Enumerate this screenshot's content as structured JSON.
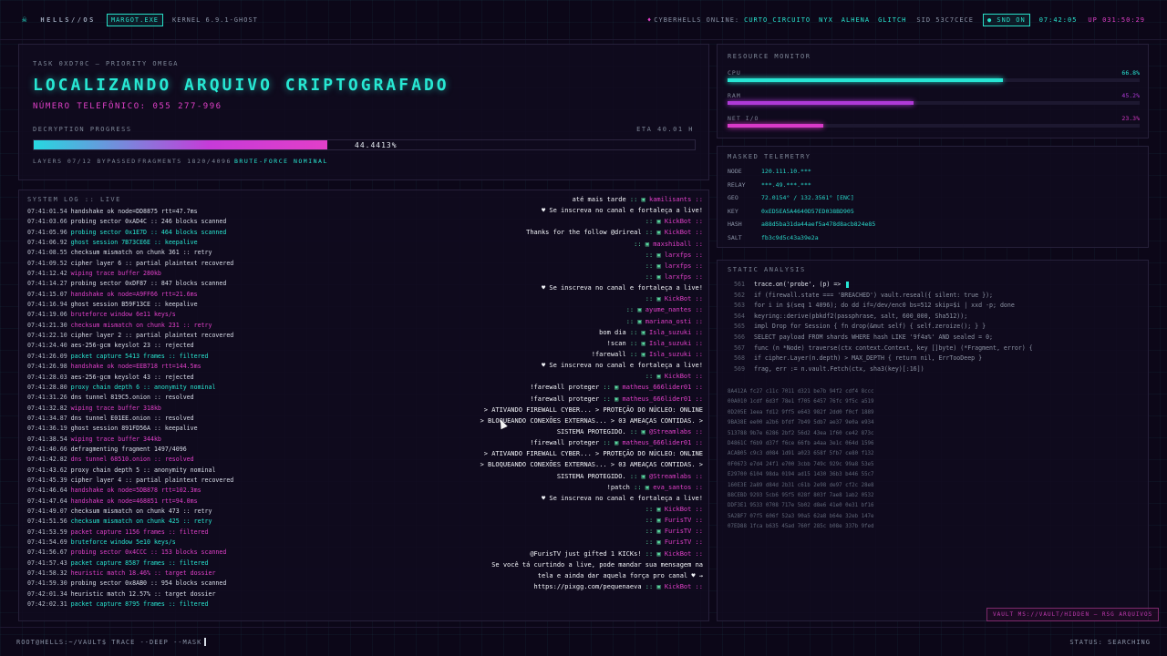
{
  "colors": {
    "bg": "#0c0718",
    "accent": "#28e6d0",
    "magenta": "#e040c8"
  },
  "topbar": {
    "logo_icon": "skull-icon",
    "brand": "HELLS//OS",
    "user_chip": "MARGOT.EXE",
    "kernel": "KERNEL 6.9.1-GHOST",
    "online_label": "CYBERHELLS ONLINE:",
    "online_users": [
      "CURTO_CIRCUITO",
      "NYX",
      "ALHENA",
      "GLITCH"
    ],
    "sid": "SID 53C7CECE",
    "snd": "SND ON",
    "time": "07:42:05",
    "uptime": "UP 031:50:29"
  },
  "task": {
    "label": "TASK 0XD70C — PRIORITY OMEGA",
    "title": "LOCALIZANDO ARQUIVO CRIPTOGRAFADO",
    "phone": "NÚMERO TELEFÔNICO: 055 277-996",
    "progress_label": "DECRYPTION PROGRESS",
    "eta": "ETA 40.01 H",
    "progress_pct": 44.4413,
    "progress_text": "44.4413%",
    "layers": "LAYERS 07/12 BYPASSED",
    "fragments": "FRAGMENTS 1820/4096",
    "bruteforce": "BRUTE-FORCE NOMINAL"
  },
  "syslog": {
    "label": "SYSTEM LOG :: LIVE",
    "lines": [
      {
        "t": "07:41:01.54",
        "m": "handshake ok node=DD8875 rtt=47.7ms",
        "c": "w"
      },
      {
        "t": "07:41:03.66",
        "m": "probing sector 0xAD4C :: 246 blocks scanned",
        "c": "w"
      },
      {
        "t": "07:41:05.96",
        "m": "probing sector 0x1E7D :: 464 blocks scanned",
        "c": "c"
      },
      {
        "t": "07:41:06.92",
        "m": "ghost session 7B73CE6E :: keepalive",
        "c": "c"
      },
      {
        "t": "07:41:08.55",
        "m": "checksum mismatch on chunk 361 :: retry",
        "c": "w"
      },
      {
        "t": "07:41:09.52",
        "m": "cipher layer 6 :: partial plaintext recovered",
        "c": "w"
      },
      {
        "t": "07:41:12.42",
        "m": "wiping trace buffer 280kb",
        "c": "p"
      },
      {
        "t": "07:41:14.27",
        "m": "probing sector 0xDF87 :: 847 blocks scanned",
        "c": "w"
      },
      {
        "t": "07:41:15.07",
        "m": "handshake ok node=A9FF66 rtt=21.6ms",
        "c": "p"
      },
      {
        "t": "07:41:16.94",
        "m": "ghost session B59F13CE :: keepalive",
        "c": "w"
      },
      {
        "t": "07:41:19.06",
        "m": "bruteforce window 6e11 keys/s",
        "c": "p"
      },
      {
        "t": "07:41:21.30",
        "m": "checksum mismatch on chunk 231 :: retry",
        "c": "p"
      },
      {
        "t": "07:41:22.10",
        "m": "cipher layer 2 :: partial plaintext recovered",
        "c": "w"
      },
      {
        "t": "07:41:24.40",
        "m": "aes-256-gcm keyslot 23 :: rejected",
        "c": "w"
      },
      {
        "t": "07:41:26.09",
        "m": "packet capture 5413 frames :: filtered",
        "c": "c"
      },
      {
        "t": "07:41:26.98",
        "m": "handshake ok node=EEB718 rtt=144.5ms",
        "c": "p"
      },
      {
        "t": "07:41:28.03",
        "m": "aes-256-gcm keyslot 43 :: rejected",
        "c": "w"
      },
      {
        "t": "07:41:28.80",
        "m": "proxy chain depth 6 :: anonymity nominal",
        "c": "c"
      },
      {
        "t": "07:41:31.26",
        "m": "dns tunnel 819C5.onion :: resolved",
        "c": "w"
      },
      {
        "t": "07:41:32.82",
        "m": "wiping trace buffer 318kb",
        "c": "p"
      },
      {
        "t": "07:41:34.87",
        "m": "dns tunnel E01EE.onion :: resolved",
        "c": "w"
      },
      {
        "t": "07:41:36.19",
        "m": "ghost session 891FD56A :: keepalive",
        "c": "w"
      },
      {
        "t": "07:41:38.54",
        "m": "wiping trace buffer 344kb",
        "c": "p"
      },
      {
        "t": "07:41:40.66",
        "m": "defragmenting fragment 1497/4096",
        "c": "w"
      },
      {
        "t": "07:41:42.82",
        "m": "dns tunnel 68510.onion :: resolved",
        "c": "p"
      },
      {
        "t": "07:41:43.62",
        "m": "proxy chain depth 5 :: anonymity nominal",
        "c": "w"
      },
      {
        "t": "07:41:45.39",
        "m": "cipher layer 4 :: partial plaintext recovered",
        "c": "w"
      },
      {
        "t": "07:41:46.64",
        "m": "handshake ok node=5DB878 rtt=102.3ms",
        "c": "p"
      },
      {
        "t": "07:41:47.64",
        "m": "handshake ok node=468851 rtt=94.0ms",
        "c": "p"
      },
      {
        "t": "07:41:49.07",
        "m": "checksum mismatch on chunk 473 :: retry",
        "c": "w"
      },
      {
        "t": "07:41:51.56",
        "m": "checksum mismatch on chunk 425 :: retry",
        "c": "c"
      },
      {
        "t": "07:41:53.59",
        "m": "packet capture 1156 frames :: filtered",
        "c": "p"
      },
      {
        "t": "07:41:54.69",
        "m": "bruteforce window 5e10 keys/s",
        "c": "c"
      },
      {
        "t": "07:41:56.67",
        "m": "probing sector 0x4CCC :: 153 blocks scanned",
        "c": "p"
      },
      {
        "t": "07:41:57.43",
        "m": "packet capture 8587 frames :: filtered",
        "c": "c"
      },
      {
        "t": "07:41:58.32",
        "m": "heuristic match 18.46% :: target dossier",
        "c": "p"
      },
      {
        "t": "07:41:59.30",
        "m": "probing sector 0x8AB0 :: 954 blocks scanned",
        "c": "w"
      },
      {
        "t": "07:42:01.34",
        "m": "heuristic match 12.57% :: target dossier",
        "c": "w"
      },
      {
        "t": "07:42:02.31",
        "m": "packet capture 8795 frames :: filtered",
        "c": "c"
      }
    ]
  },
  "chat": [
    {
      "msg": "até mais tarde",
      "user": "kamilisants"
    },
    {
      "msg": "♥ Se inscreva no canal e fortaleça a live!",
      "user": ""
    },
    {
      "msg": "",
      "user": "KickBot"
    },
    {
      "msg": "Thanks for the follow @drireal",
      "user": "KickBot"
    },
    {
      "msg": "",
      "user": "maxshiball"
    },
    {
      "msg": "",
      "user": "larxfps"
    },
    {
      "msg": "",
      "user": "larxfps"
    },
    {
      "msg": "",
      "user": "larxfps"
    },
    {
      "msg": "♥ Se inscreva no canal e fortaleça a live!",
      "user": ""
    },
    {
      "msg": "",
      "user": "KickBot"
    },
    {
      "msg": "",
      "user": "ayume_nantes"
    },
    {
      "msg": "",
      "user": "mariana_osti"
    },
    {
      "msg": "bom dia",
      "user": "Isla_suzuki"
    },
    {
      "msg": "!scan",
      "user": "Isla_suzuki"
    },
    {
      "msg": "!farewall",
      "user": "Isla_suzuki"
    },
    {
      "msg": "♥ Se inscreva no canal e fortaleça a live!",
      "user": ""
    },
    {
      "msg": "",
      "user": "KickBot"
    },
    {
      "msg": "!farewall proteger",
      "user": "matheus_666lider01"
    },
    {
      "msg": "!farewall proteger",
      "user": "matheus_666lider01"
    },
    {
      "msg": "> ATIVANDO FIREWALL CYBER... > PROTEÇÃO DO NÚCLEO: ONLINE",
      "user": ""
    },
    {
      "msg": "> BLOQUEANDO CONEXÕES EXTERNAS... > 03 AMEAÇAS CONTIDAS. >",
      "user": ""
    },
    {
      "msg": "SISTEMA PROTEGIDO.",
      "user": "@Streamlabs"
    },
    {
      "msg": "!firewall proteger",
      "user": "matheus_666lider01"
    },
    {
      "msg": "> ATIVANDO FIREWALL CYBER... > PROTEÇÃO DO NÚCLEO: ONLINE",
      "user": ""
    },
    {
      "msg": "> BLOQUEANDO CONEXÕES EXTERNAS... > 03 AMEAÇAS CONTIDAS. >",
      "user": ""
    },
    {
      "msg": "SISTEMA PROTEGIDO.",
      "user": "@Streamlabs"
    },
    {
      "msg": "!patch",
      "user": "eva_santos"
    },
    {
      "msg": "♥ Se inscreva no canal e fortaleça a live!",
      "user": ""
    },
    {
      "msg": "",
      "user": "KickBot"
    },
    {
      "msg": "",
      "user": "FurisTV"
    },
    {
      "msg": "",
      "user": "FurisTV"
    },
    {
      "msg": "",
      "user": "FurisTV"
    },
    {
      "msg": "@FurisTV just gifted 1 KICKs!",
      "user": "KickBot"
    },
    {
      "msg": "Se você tá curtindo a live, pode mandar sua mensagem na",
      "user": ""
    },
    {
      "msg": "tela e ainda dar aquela força pro canal ♥ →",
      "user": ""
    },
    {
      "msg": "https://pixgg.com/pequenaeva",
      "user": "KickBot"
    }
  ],
  "resources": {
    "label": "RESOURCE MONITOR",
    "items": [
      {
        "name": "CPU",
        "pct": 66.8,
        "text": "66.8%",
        "color": "#27e6d4"
      },
      {
        "name": "RAM",
        "pct": 45.2,
        "text": "45.2%",
        "color": "#b03ad8"
      },
      {
        "name": "NET I/O",
        "pct": 23.3,
        "text": "23.3%",
        "color": "#d83ac8"
      }
    ]
  },
  "telemetry": {
    "label": "MASKED TELEMETRY",
    "rows": [
      {
        "k": "NODE",
        "v": "120.111.10.***"
      },
      {
        "k": "RELAY",
        "v": "***.49.***.***"
      },
      {
        "k": "GEO",
        "v": "72.0154° / 132.3561° [ENC]"
      },
      {
        "k": "KEY",
        "v": "0xED5EA5A4640D57ED038BD905"
      },
      {
        "k": "HASH",
        "v": "a88d5ba31da44aef5a478d8acb824e85"
      },
      {
        "k": "SALT",
        "v": "fb3c9d5c43a39e2a"
      }
    ]
  },
  "static": {
    "label": "STATIC ANALYSIS",
    "code": [
      {
        "n": "561",
        "t": "trace.on('probe', (p) => "
      },
      {
        "n": "562",
        "t": "if (firewall.state === 'BREACHED') vault.reseal({ silent: true });"
      },
      {
        "n": "563",
        "t": "for i in $(seq 1 4096); do dd if=/dev/enc0 bs=512 skip=$i | xxd -p; done"
      },
      {
        "n": "564",
        "t": "keyring::derive(pbkdf2(passphrase, salt, 600_000, Sha512));"
      },
      {
        "n": "565",
        "t": "impl Drop for Session { fn drop(&mut self) { self.zeroize(); } }"
      },
      {
        "n": "566",
        "t": "SELECT payload FROM shards WHERE hash LIKE '9f4a%' AND sealed = 0;"
      },
      {
        "n": "567",
        "t": "func (n *Node) traverse(ctx context.Context, key []byte) (*Fragment, error) {"
      },
      {
        "n": "568",
        "t": "if cipher.Layer(n.depth) > MAX_DEPTH { return nil, ErrTooDeep }"
      },
      {
        "n": "569",
        "t": "frag, err := n.vault.Fetch(ctx, sha3(key)[:16])"
      }
    ],
    "hex": [
      "8A412A fc27 c11c 7011 d321 be7b 94f2 cdf4 8ccc",
      "00A010 1cdf 6d3f 78e1 f705 6457 76fc 9f5c a519",
      "0D205E 1eea fd12 9ff5 e643 982f 2dd0 f0cf 1889",
      "9BA38E ee00 a2b6 bfdf 7b49 5db7 ae37 9e0a e934",
      "513788 9b7e 6286 2bf2 56d2 43ea 1f60 ce42 873c",
      "D4861C f6b9 d37f f6ce 66fb a4aa 3e1c 064d 1596",
      "ACAB05 c9c3 d084 1d91 a023 658f 5fb7 ce80 f132",
      "0F0673 e7d4 24f1 e700 3cbb 749c 929c 99a8 53e5",
      "E29700 6104 98da 0194 ad15 1430 36b3 b446 55c7",
      "160E3E 2a89 d84d 2b31 c61b 2e98 de97 cf2c 28e8",
      "B8CEBD 9293 5cb6 95f5 028f 803f 7ae8 1ab2 0532",
      "DDF3E1 9533 0708 717e 5b02 d8e6 41e0 0e31 bf16",
      "5A2BF7 07f5 606f 52a3 90a5 62a8 b64e 32eb 147e",
      "07ED88 1fca b635 45ad 760f 285c b08e 337b 9fed"
    ]
  },
  "vault": "VAULT MS://VAULT/HIDDEN — RSG ARQUIVOS",
  "bottombar": {
    "prompt": "ROOT@HELLS:~/VAULT$ TRACE --DEEP --MASK",
    "status": "STATUS: SEARCHING"
  }
}
